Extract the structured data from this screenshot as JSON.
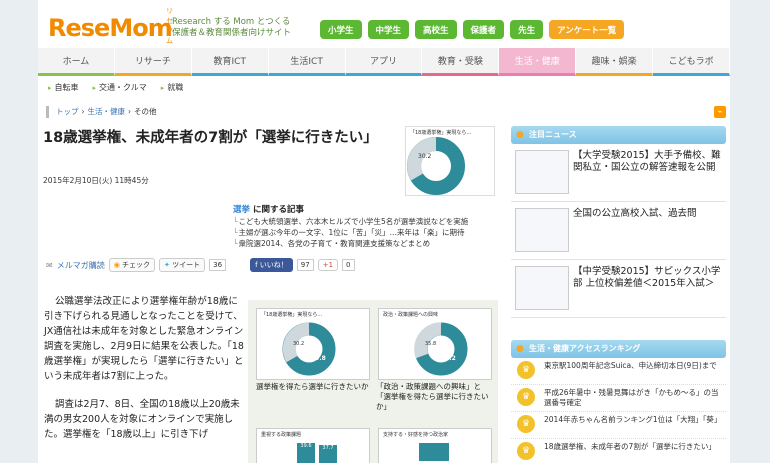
{
  "header": {
    "logo": "ReseMom",
    "logo_ruby": "リセマム",
    "tagline_line1": "Research する Mom とつくる",
    "tagline_line2": "保護者＆教育関係者向けサイト",
    "grade_buttons": [
      "小学生",
      "中学生",
      "高校生",
      "保護者",
      "先生"
    ],
    "survey_button": "アンケート一覧"
  },
  "main_nav": [
    "ホーム",
    "リサーチ",
    "教育ICT",
    "生活ICT",
    "アプリ",
    "教育・受験",
    "生活・健康",
    "趣味・娯楽",
    "こどもラボ"
  ],
  "sub_nav": [
    "自転車",
    "交通・クルマ",
    "就職"
  ],
  "breadcrumb": [
    "トップ",
    "生活・健康",
    "その他"
  ],
  "article": {
    "title": "18歳選挙権、未成年者の7割が「選挙に行きたい」",
    "date": "2015年2月10日(火) 11時45分",
    "related_heading_1": "選挙",
    "related_heading_2": "に関する記事",
    "related": [
      "こども大統領選挙、六本木ヒルズで小学生5名が選挙演説などを実施",
      "主婦が選ぶ今年の一文字、1位に「苦」「災」…来年は「楽」に期待",
      "衆院選2014、各党の子育て・教育関連支援策などまとめ"
    ],
    "share": {
      "mail": "メルマガ購読",
      "check": "チェック",
      "tweet": "ツイート",
      "tweet_count": "36",
      "like": "いいね！",
      "like_count": "97",
      "gplus": "+1",
      "gplus_count": "0"
    },
    "paragraphs": [
      "公職選挙法改正により選挙権年齢が18歳に引き下げられる見通しとなったことを受けて、JX通信社は未成年を対象とした緊急オンライン調査を実施し、2月9日に結果を公表した。「18歳選挙権」が実現したら「選挙に行きたい」という未成年者は7割に上った。",
      "調査は2月7、8日、全国の18歳以上20歳未満の男女200人を対象にオンラインで実施した。選挙権を「18歳以上」に引き下げ"
    ],
    "thumb_title": "「18歳選挙権」実現なら…",
    "thumb_value_main": "69.8",
    "thumb_value_sub": "30.2",
    "figures": [
      {
        "title": "「18歳選挙権」実現なら…",
        "v1": "69.8",
        "v2": "30.2",
        "caption": "選挙権を得たら選挙に行きたいか"
      },
      {
        "title": "政治・政策課題への興味",
        "v1": "64.2",
        "v2": "35.8",
        "caption": "「政治・政策課題への興味」と「選挙権を得たら選挙に行きたいか」"
      },
      {
        "title": "重視する政策課題",
        "v1": "39.6",
        "v2": "37.7",
        "caption": ""
      },
      {
        "title": "支持する・好感を持つ政治家",
        "v1": "",
        "v2": "",
        "caption": ""
      }
    ]
  },
  "sidebar": {
    "news_heading": "注目ニュース",
    "news": [
      "【大学受験2015】大手予備校、難関私立・国公立の解答速報を公開",
      "全国の公立高校入試、過去問",
      "【中学受験2015】サピックス小学部 上位校偏差値＜2015年入試＞"
    ],
    "ranking_heading": "生活・健康アクセスランキング",
    "ranking": [
      "東京駅100周年記念Suica、申込締切本日(9日)まで",
      "平成26年暑中・残暑見舞はがき「かもめ～る」の当選番号確定",
      "2014年赤ちゃん名前ランキング1位は「大翔」「葵」",
      "18歳選挙権、未成年者の7割が「選挙に行きたい」"
    ]
  }
}
